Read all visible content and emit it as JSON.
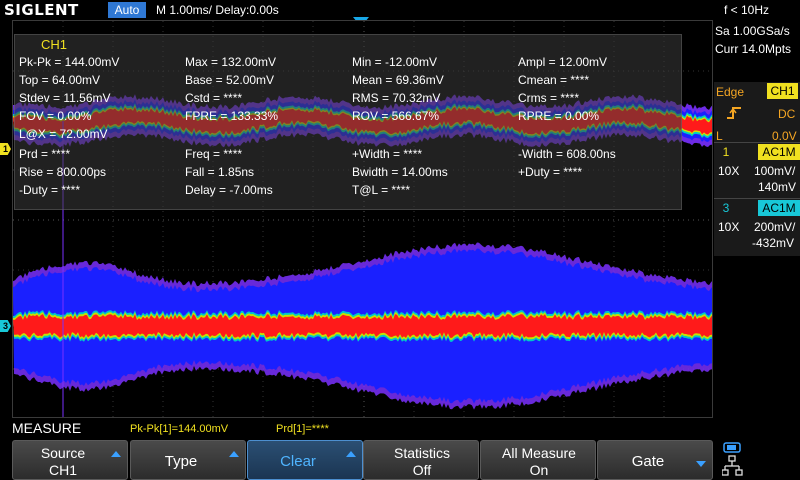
{
  "topbar": {
    "logo": "SIGLENT",
    "mode": "Auto",
    "timebase": "M 1.00ms/ Delay:0.00s",
    "frequency": "f < 10Hz"
  },
  "measure_panel": {
    "channel": "CH1",
    "items": [
      "Pk-Pk = 144.00mV",
      "Max = 132.00mV",
      "Min = -12.00mV",
      "Ampl = 12.00mV",
      "Top = 64.00mV",
      "Base = 52.00mV",
      "Mean = 69.36mV",
      "Cmean = ****",
      "Stdev = 11.56mV",
      "Cstd = ****",
      "RMS = 70.32mV",
      "Crms = ****",
      "FOV = 0.00%",
      "FPRE = 133.33%",
      "ROV = 566.67%",
      "RPRE = 0.00%",
      "L@X = 72.00mV",
      "",
      "",
      "",
      "Prd = ****",
      "Freq = ****",
      "+Width = ****",
      "-Width = 608.00ns",
      "Rise = 800.00ps",
      "Fall = 1.85ns",
      "Bwidth = 14.00ms",
      "+Duty = ****",
      "-Duty = ****",
      "Delay = -7.00ms",
      "T@L = ****",
      ""
    ]
  },
  "markers": {
    "ch1": "1",
    "ch3": "3"
  },
  "right_panel": {
    "sample_rate": "Sa 1.00GSa/s",
    "memory": "Curr 14.0Mpts",
    "trigger": {
      "type": "Edge",
      "source": "CH1",
      "coupling": "DC",
      "level_label": "L",
      "level": "0.0V"
    },
    "channel1": {
      "num": "1",
      "coupling": "AC1M",
      "probe": "10X",
      "scale": "100mV/",
      "offset": "140mV"
    },
    "channel3": {
      "num": "3",
      "coupling": "AC1M",
      "probe": "10X",
      "scale": "200mV/",
      "offset": "-432mV"
    }
  },
  "status": {
    "menu_title": "MEASURE",
    "pkpk": "Pk-Pk[1]=144.00mV",
    "prd": "Prd[1]=****"
  },
  "menu": {
    "source": {
      "l1": "Source",
      "l2": "CH1"
    },
    "type": "Type",
    "clear": "Clear",
    "statistics": {
      "l1": "Statistics",
      "l2": "Off"
    },
    "all_measure": {
      "l1": "All Measure",
      "l2": "On"
    },
    "gate": "Gate"
  },
  "colors": {
    "ch1": "#f0e020",
    "ch3": "#18c8d8",
    "accent": "#2f78d4",
    "trace_red": "#ff1a1a",
    "trace_blue": "#1a20ff",
    "trace_violet": "#7a30ff"
  },
  "icons": [
    "edge-rising-icon",
    "usb-icon",
    "network-icon",
    "arrow-up-icon",
    "arrow-down-icon"
  ]
}
